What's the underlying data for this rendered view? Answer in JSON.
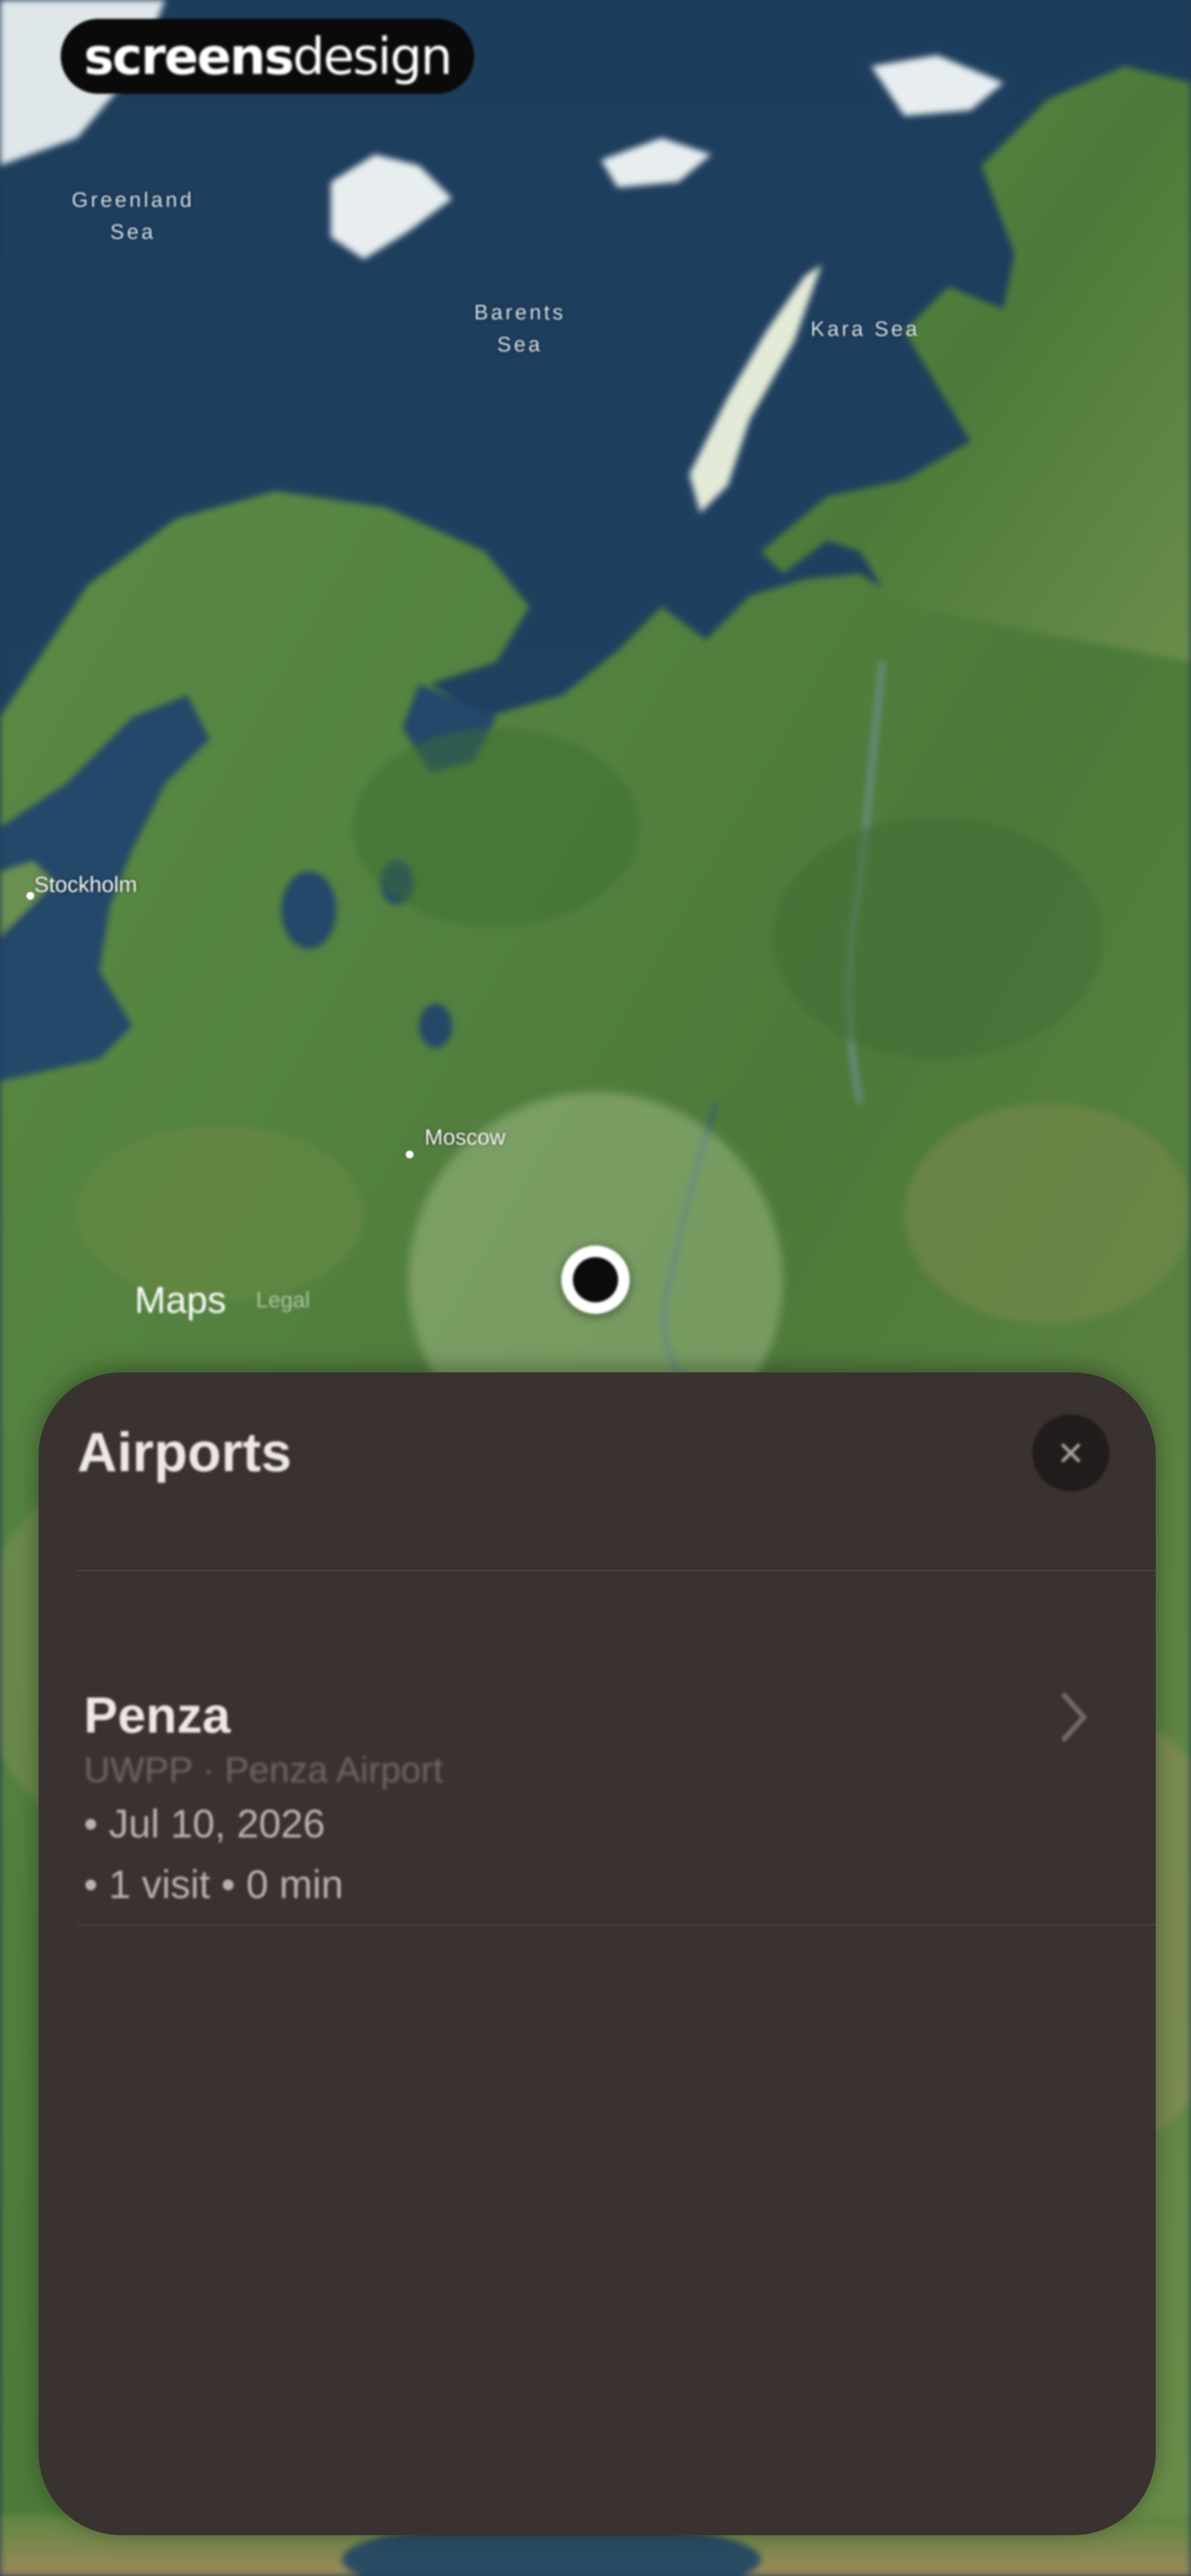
{
  "watermark": {
    "bold": "screens",
    "light": "design"
  },
  "map": {
    "sea_labels": [
      {
        "name": "greenland-sea",
        "text": "Greenland\nSea"
      },
      {
        "name": "barents-sea",
        "text": "Barents\nSea"
      },
      {
        "name": "kara-sea",
        "text": "Kara Sea"
      }
    ],
    "cities": [
      {
        "name": "stockholm",
        "text": "Stockholm"
      },
      {
        "name": "moscow",
        "text": "Moscow"
      }
    ],
    "attribution": {
      "logo": "",
      "brand": "Maps",
      "legal": "Legal"
    },
    "region_color": "#e6f0c8"
  },
  "sheet": {
    "title": "Airports",
    "close_icon": "close-icon",
    "airports": [
      {
        "name": "Penza",
        "code_line": "UWPP · Penza Airport",
        "date_line": "• Jul 10, 2026",
        "visits_line": "• 1 visit • 0 min"
      }
    ]
  },
  "colors": {
    "sheet_bg": "#3a3230",
    "ocean": "#1f3b55",
    "land": "#4f7a3d"
  }
}
